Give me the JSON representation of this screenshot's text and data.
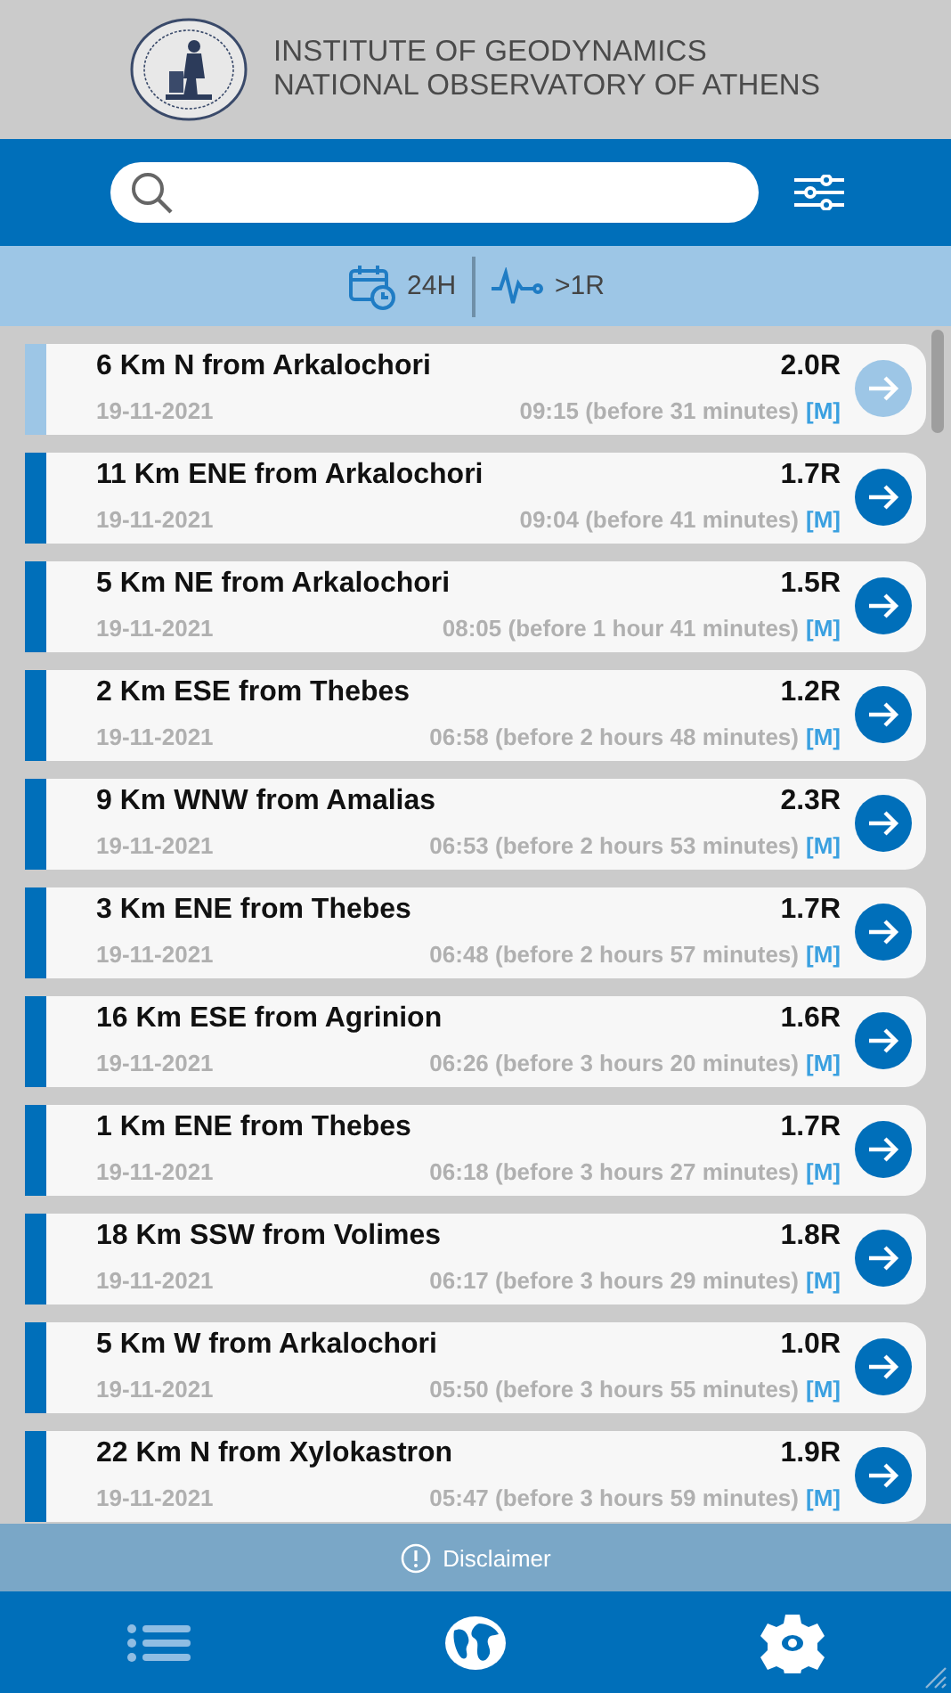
{
  "header": {
    "title_lines": [
      "INSTITUTE OF GEODYNAMICS",
      "NATIONAL OBSERVATORY OF ATHENS"
    ]
  },
  "filters": [
    {
      "kind": "time",
      "label": "24H"
    },
    {
      "kind": "magnitude",
      "label": ">1R"
    }
  ],
  "events": [
    {
      "location": "6 Km N from Arkalochori",
      "magnitude": "2.0R",
      "date": "19-11-2021",
      "time": "09:15 (before 31 minutes)",
      "type": "[M]",
      "selected": true
    },
    {
      "location": "11 Km ENE from Arkalochori",
      "magnitude": "1.7R",
      "date": "19-11-2021",
      "time": "09:04 (before 41 minutes)",
      "type": "[M]",
      "selected": false
    },
    {
      "location": "5 Km NE from Arkalochori",
      "magnitude": "1.5R",
      "date": "19-11-2021",
      "time": "08:05 (before 1 hour 41 minutes)",
      "type": "[M]",
      "selected": false
    },
    {
      "location": "2 Km ESE from Thebes",
      "magnitude": "1.2R",
      "date": "19-11-2021",
      "time": "06:58 (before 2 hours 48 minutes)",
      "type": "[M]",
      "selected": false
    },
    {
      "location": "9 Km WNW from Amalias",
      "magnitude": "2.3R",
      "date": "19-11-2021",
      "time": "06:53 (before 2 hours 53 minutes)",
      "type": "[M]",
      "selected": false
    },
    {
      "location": "3 Km ENE from Thebes",
      "magnitude": "1.7R",
      "date": "19-11-2021",
      "time": "06:48 (before 2 hours 57 minutes)",
      "type": "[M]",
      "selected": false
    },
    {
      "location": "16 Km ESE from Agrinion",
      "magnitude": "1.6R",
      "date": "19-11-2021",
      "time": "06:26 (before 3 hours 20 minutes)",
      "type": "[M]",
      "selected": false
    },
    {
      "location": "1 Km ENE from Thebes",
      "magnitude": "1.7R",
      "date": "19-11-2021",
      "time": "06:18 (before 3 hours 27 minutes)",
      "type": "[M]",
      "selected": false
    },
    {
      "location": "18 Km SSW from Volimes",
      "magnitude": "1.8R",
      "date": "19-11-2021",
      "time": "06:17 (before 3 hours 29 minutes)",
      "type": "[M]",
      "selected": false
    },
    {
      "location": "5 Km W from Arkalochori",
      "magnitude": "1.0R",
      "date": "19-11-2021",
      "time": "05:50 (before 3 hours 55 minutes)",
      "type": "[M]",
      "selected": false
    },
    {
      "location": "22 Km N from Xylokastron",
      "magnitude": "1.9R",
      "date": "19-11-2021",
      "time": "05:47 (before 3 hours 59 minutes)",
      "type": "[M]",
      "selected": false
    }
  ],
  "disclaimer": {
    "label": "Disclaimer"
  },
  "nav_tabs": [
    {
      "kind": "list",
      "selected": true
    },
    {
      "kind": "globe",
      "selected": false
    },
    {
      "kind": "settings",
      "selected": false
    }
  ]
}
